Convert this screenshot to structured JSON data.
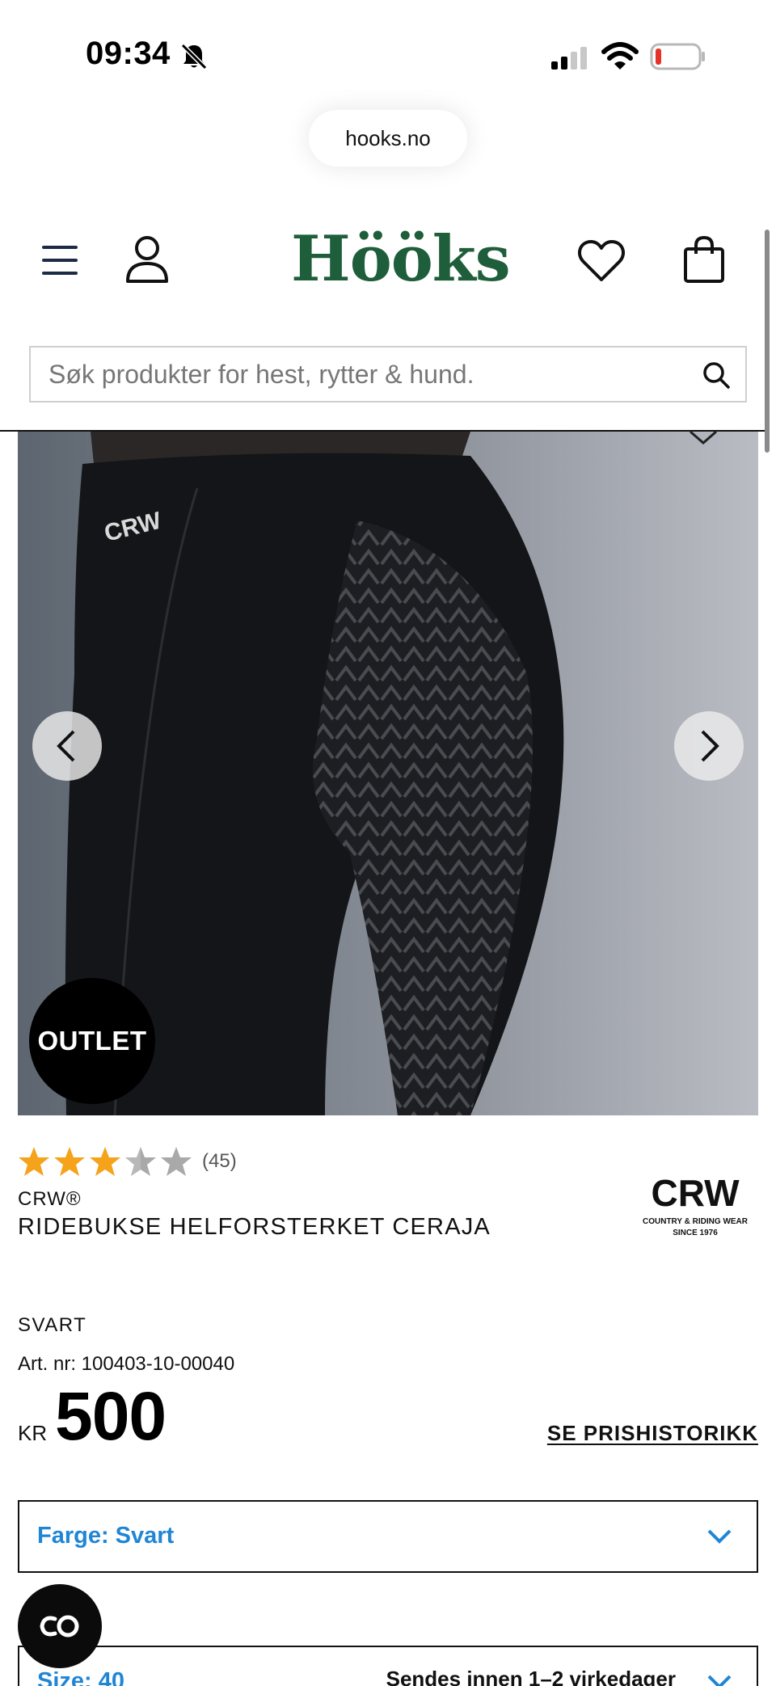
{
  "status_bar": {
    "time": "09:34",
    "icons": [
      "bell-slash-icon",
      "cellular-signal-icon",
      "wifi-icon",
      "battery-low-icon"
    ]
  },
  "browser": {
    "url": "hooks.no"
  },
  "header": {
    "logo_text": "Hööks",
    "icons": [
      "hamburger-menu-icon",
      "account-icon",
      "heart-icon",
      "shopping-bag-icon"
    ],
    "colors": {
      "logo": "#1f5e3a",
      "accent": "#1f86d6"
    }
  },
  "search": {
    "placeholder": "Søk produkter for hest, rytter & hund."
  },
  "product": {
    "badge": "OUTLET",
    "rating_value": 3.5,
    "rating_max": 5,
    "review_count": "(45)",
    "brand": "CRW®",
    "title": "RIDEBUKSE HELFORSTERKET CERAJA",
    "brand_logo": {
      "name": "CRW",
      "tagline": "COUNTRY & RIDING WEAR",
      "since": "SINCE 1976"
    },
    "color": "SVART",
    "art_nr": "Art. nr: 100403-10-00040",
    "price_currency": "KR",
    "price": "500",
    "price_history_link": "SE PRISHISTORIKK"
  },
  "selectors": {
    "color_label": "Farge: Svart",
    "size_label": "Size: 40",
    "shipping_note": "Sendes innen 1–2 virkedager"
  }
}
